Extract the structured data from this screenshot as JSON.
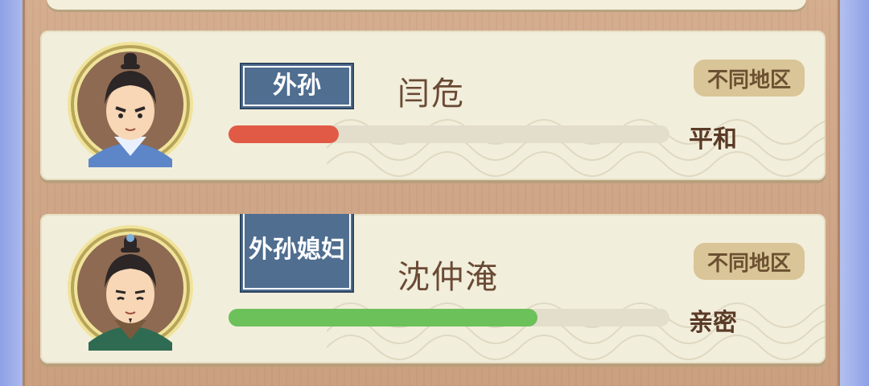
{
  "relatives": [
    {
      "relation": "外孙",
      "name": "闫危",
      "region": "不同地区",
      "mood": "平和",
      "affinity": 0.25,
      "bar_color": "#e05a45"
    },
    {
      "relation": "外孙媳妇",
      "name": "沈仲淹",
      "region": "不同地区",
      "mood": "亲密",
      "affinity": 0.7,
      "bar_color": "#6cc15a"
    }
  ],
  "colors": {
    "tag_bg": "#4f6e90",
    "card_bg": "#f2eedc",
    "wood": "#d5ad8f",
    "region_bg": "#d9c597"
  }
}
